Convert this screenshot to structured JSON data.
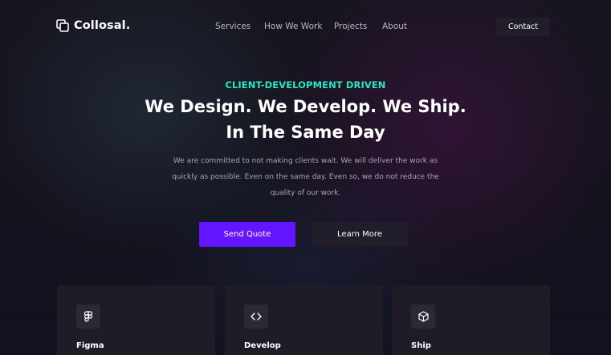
{
  "brand": {
    "name": "Collosal.",
    "icon": "overlapping-squares-logo-icon"
  },
  "nav": {
    "links": [
      "Services",
      "How We Work",
      "Projects",
      "About"
    ],
    "contact_label": "Contact"
  },
  "hero": {
    "eyebrow": "CLIENT-DEVELOPMENT DRIVEN",
    "headline_line1": "We Design. We Develop. We Ship.",
    "headline_line2": "In The Same Day",
    "description": "We are committed to not making clients wait. We will deliver the work as quickly as possible. Even on the same day. Even so, we do not reduce the quality of our work.",
    "primary_button": "Send Quote",
    "secondary_button": "Learn More"
  },
  "features": [
    {
      "title": "Figma",
      "icon": "figma-icon"
    },
    {
      "title": "Develop",
      "icon": "code-brackets-icon"
    },
    {
      "title": "Ship",
      "icon": "cube-icon"
    }
  ],
  "colors": {
    "accent": "#6415ff",
    "eyebrow": "#2ee6c4",
    "background": "#14121d",
    "card": "#1f1c28",
    "dark_button": "#211d2b"
  }
}
